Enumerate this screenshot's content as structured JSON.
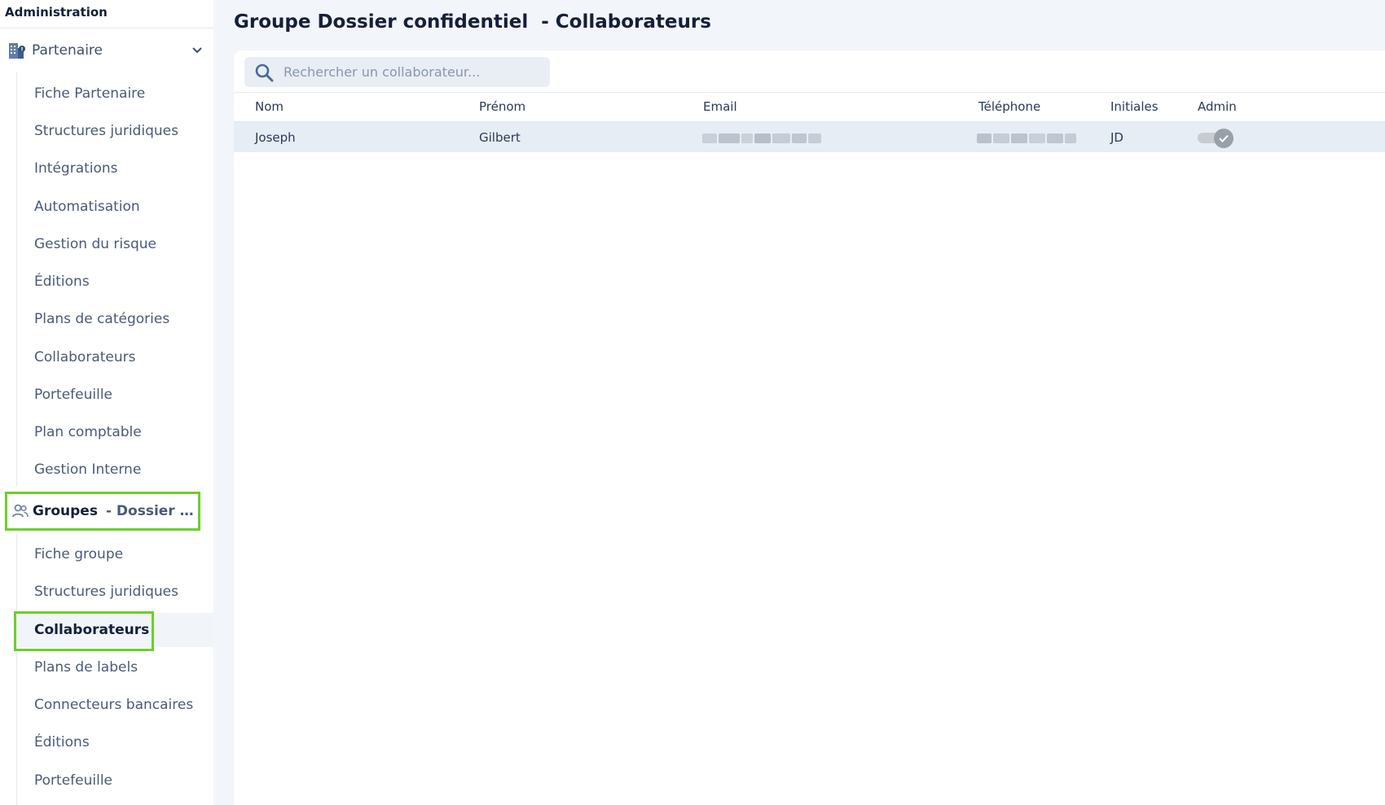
{
  "sidebar": {
    "title": "Administration",
    "partenaire_section": {
      "label": "Partenaire",
      "items": [
        {
          "label": "Fiche Partenaire"
        },
        {
          "label": "Structures juridiques"
        },
        {
          "label": "Intégrations"
        },
        {
          "label": "Automatisation"
        },
        {
          "label": "Gestion du risque"
        },
        {
          "label": "Éditions"
        },
        {
          "label": "Plans de catégories"
        },
        {
          "label": "Collaborateurs"
        },
        {
          "label": "Portefeuille"
        },
        {
          "label": "Plan comptable"
        },
        {
          "label": "Gestion Interne"
        }
      ]
    },
    "groupes_section": {
      "label": "Groupes",
      "sub_label": "- Dossier confidentiel",
      "items": [
        {
          "label": "Fiche groupe"
        },
        {
          "label": "Structures juridiques"
        },
        {
          "label": "Collaborateurs",
          "active": true
        },
        {
          "label": "Plans de labels"
        },
        {
          "label": "Connecteurs bancaires"
        },
        {
          "label": "Éditions"
        },
        {
          "label": "Portefeuille"
        }
      ]
    }
  },
  "main": {
    "title": "Groupe Dossier confidentiel  - Collaborateurs",
    "search": {
      "placeholder": "Rechercher un collaborateur...",
      "value": ""
    },
    "table": {
      "columns": [
        "Nom",
        "Prénom",
        "Email",
        "Téléphone",
        "Initiales",
        "Admin"
      ],
      "rows": [
        {
          "nom": "Joseph",
          "prenom": "Gilbert",
          "email": "",
          "telephone": "",
          "initiales": "JD",
          "admin": true
        }
      ]
    }
  },
  "colors": {
    "highlight": "#6ccf2d",
    "title_text": "#14203a",
    "selected_row": "#e7edf4",
    "toggle_knob": "#9aa0a8"
  },
  "icons": {
    "partenaire": "building-icon",
    "groupes": "users-icon",
    "search": "search-icon",
    "chevron": "chevron-down-icon",
    "toggle": "check-icon"
  }
}
